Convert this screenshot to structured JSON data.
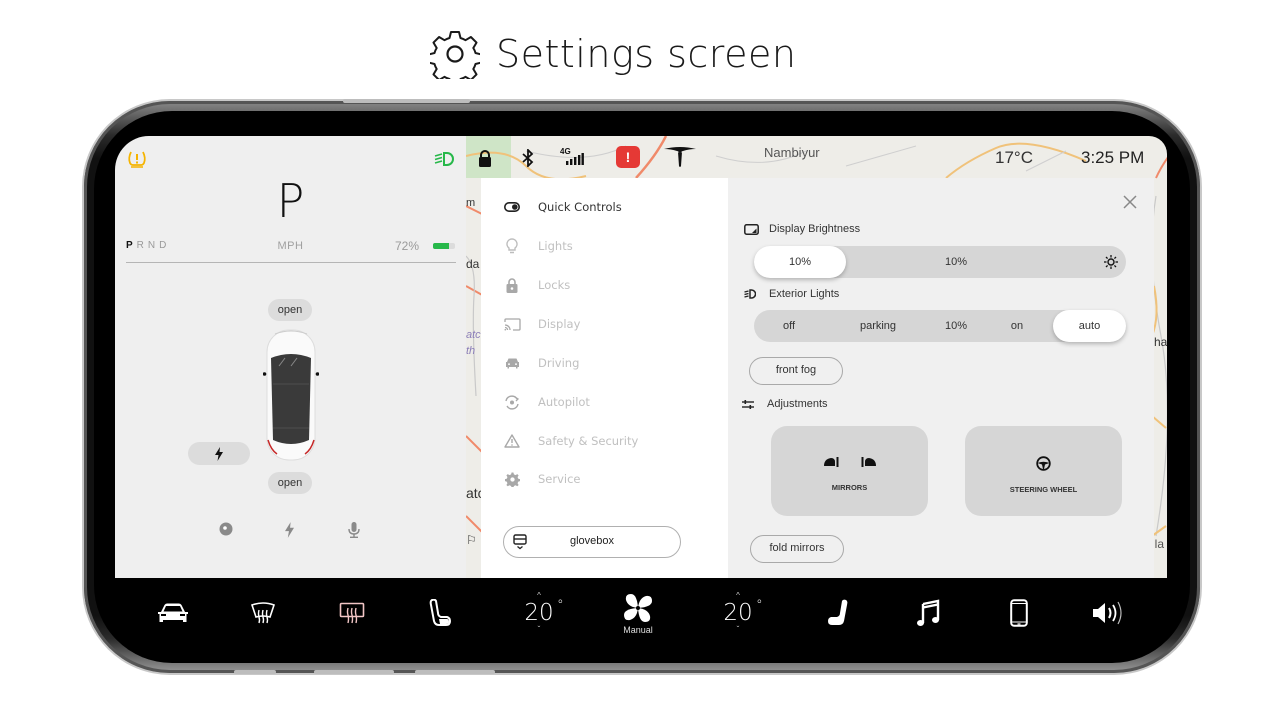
{
  "page": {
    "title": "Settings screen"
  },
  "left_panel": {
    "gear_current": "P",
    "gears": [
      "P",
      "R",
      "N",
      "D"
    ],
    "active_gear": "P",
    "speed_unit": "MPH",
    "battery_percent_label": "72%",
    "battery_level": 0.72,
    "frunk_label": "open",
    "trunk_label": "open",
    "colors": {
      "tpms_warning": "#f5b400",
      "headlights_on": "#27b84a",
      "battery": "#27b84a"
    }
  },
  "status_bar": {
    "place_label": "Nambiyur",
    "temperature": "17°C",
    "time": "3:25 PM",
    "network": "4G",
    "alert_color": "#e53935"
  },
  "menu": {
    "items": [
      {
        "label": "Quick Controls",
        "icon": "toggle-icon",
        "active": true
      },
      {
        "label": "Lights",
        "icon": "bulb-icon",
        "active": false
      },
      {
        "label": "Locks",
        "icon": "lock-icon",
        "active": false
      },
      {
        "label": "Display",
        "icon": "cast-display-icon",
        "active": false
      },
      {
        "label": "Driving",
        "icon": "car-icon",
        "active": false
      },
      {
        "label": "Autopilot",
        "icon": "autopilot-icon",
        "active": false
      },
      {
        "label": "Safety & Security",
        "icon": "warning-icon",
        "active": false
      },
      {
        "label": "Service",
        "icon": "gear-icon",
        "active": false
      }
    ],
    "glovebox_label": "glovebox"
  },
  "quick_controls": {
    "display_brightness": {
      "label": "Display Brightness",
      "selected_value": "10%",
      "center_value": "10%"
    },
    "exterior_lights": {
      "label": "Exterior Lights",
      "options": [
        "off",
        "parking",
        "10%",
        "on",
        "auto"
      ],
      "selected": "auto"
    },
    "front_fog_label": "front fog",
    "adjustments": {
      "label": "Adjustments",
      "cards": [
        {
          "label": "MIRRORS"
        },
        {
          "label": "STEERING WHEEL"
        }
      ]
    },
    "fold_mirrors_label": "fold mirrors"
  },
  "dock": {
    "driver_temp": "20",
    "passenger_temp": "20",
    "degree_symbol": "°",
    "fan_mode": "Manual",
    "rear_defrost_color": "#f2c6c6"
  }
}
